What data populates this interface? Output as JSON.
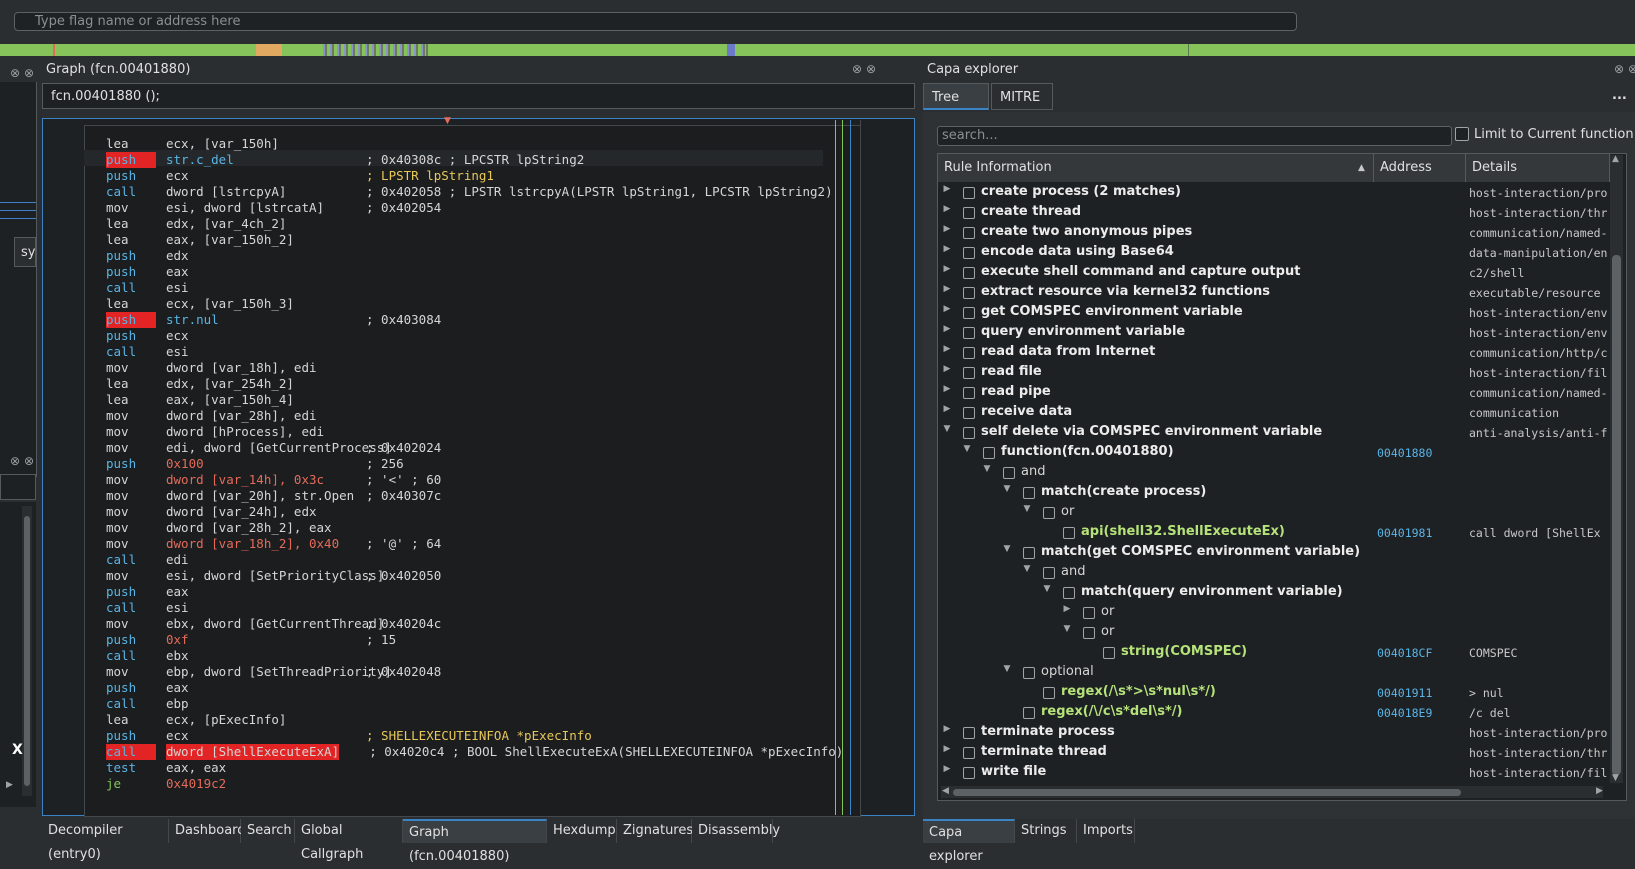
{
  "flag_search": {
    "placeholder": "Type flag name or address here"
  },
  "graph": {
    "title": "Graph (fcn.00401880)",
    "header": "fcn.00401880 ();",
    "lines": [
      {
        "mn": "lea",
        "op": "ecx, [var_150h]",
        "cm": ""
      },
      {
        "mn": "push",
        "hl": true,
        "op": "str.c_del",
        "cm": "; 0x40308c ; LPCSTR lpString2"
      },
      {
        "mn": "push",
        "op": "ecx",
        "cm": "; LPSTR lpString1"
      },
      {
        "mn": "call",
        "op": "dword [lstrcpyA]",
        "cm": "; 0x402058 ; LPSTR lstrcpyA(LPSTR lpString1, LPCSTR lpString2)"
      },
      {
        "mn": "mov",
        "op": "esi, dword [lstrcatA]",
        "cm": "; 0x402054"
      },
      {
        "mn": "lea",
        "op": "edx, [var_4ch_2]",
        "cm": ""
      },
      {
        "mn": "lea",
        "op": "eax, [var_150h_2]",
        "cm": ""
      },
      {
        "mn": "push",
        "op": "edx",
        "cm": ""
      },
      {
        "mn": "push",
        "op": "eax",
        "cm": ""
      },
      {
        "mn": "call",
        "op": "esi",
        "cm": ""
      },
      {
        "mn": "lea",
        "op": "ecx, [var_150h_3]",
        "cm": ""
      },
      {
        "mn": "push",
        "hl": true,
        "op": "str.nul",
        "cm": "; 0x403084"
      },
      {
        "mn": "push",
        "op": "ecx",
        "cm": ""
      },
      {
        "mn": "call",
        "op": "esi",
        "cm": ""
      },
      {
        "mn": "mov",
        "op": "dword [var_18h], edi",
        "cm": ""
      },
      {
        "mn": "lea",
        "op": "edx, [var_254h_2]",
        "cm": ""
      },
      {
        "mn": "lea",
        "op": "eax, [var_150h_4]",
        "cm": ""
      },
      {
        "mn": "mov",
        "op": "dword [var_28h], edi",
        "cm": ""
      },
      {
        "mn": "mov",
        "op": "dword [hProcess], edi",
        "cm": ""
      },
      {
        "mn": "mov",
        "op": "edi, dword [GetCurrentProcess]",
        "cm": "; 0x402024"
      },
      {
        "mn": "push",
        "op": "0x100",
        "cm": "; 256"
      },
      {
        "mn": "mov",
        "op": "dword [var_14h], 0x3c",
        "cm": "; '<' ; 60"
      },
      {
        "mn": "mov",
        "op": "dword [var_20h], str.Open",
        "cm": "; 0x40307c"
      },
      {
        "mn": "mov",
        "op": "dword [var_24h], edx",
        "cm": ""
      },
      {
        "mn": "mov",
        "op": "dword [var_28h_2], eax",
        "cm": ""
      },
      {
        "mn": "mov",
        "op": "dword [var_18h_2], 0x40",
        "cm": "; '@' ; 64"
      },
      {
        "mn": "call",
        "op": "edi",
        "cm": ""
      },
      {
        "mn": "mov",
        "op": "esi, dword [SetPriorityClass]",
        "cm": "; 0x402050"
      },
      {
        "mn": "push",
        "op": "eax",
        "cm": ""
      },
      {
        "mn": "call",
        "op": "esi",
        "cm": ""
      },
      {
        "mn": "mov",
        "op": "ebx, dword [GetCurrentThread]",
        "cm": "; 0x40204c"
      },
      {
        "mn": "push",
        "op": "0xf",
        "cm": "; 15"
      },
      {
        "mn": "call",
        "op": "ebx",
        "cm": ""
      },
      {
        "mn": "mov",
        "op": "ebp, dword [SetThreadPriority]",
        "cm": "; 0x402048"
      },
      {
        "mn": "push",
        "op": "eax",
        "cm": ""
      },
      {
        "mn": "call",
        "op": "ebp",
        "cm": ""
      },
      {
        "mn": "lea",
        "op": "ecx, [pExecInfo]",
        "cm": ""
      },
      {
        "mn": "push",
        "op": "ecx",
        "cm": "; SHELLEXECUTEINFOA *pExecInfo"
      },
      {
        "mn": "call",
        "hl": true,
        "op": "dword [ShellExecuteExA]",
        "cm": "; 0x4020c4 ; BOOL ShellExecuteExA(SHELLEXECUTEINFOA *pExecInfo)"
      },
      {
        "mn": "test",
        "op": "eax, eax",
        "cm": ""
      },
      {
        "mn": "je",
        "op": "0x4019c2",
        "cm": ""
      }
    ]
  },
  "left_strip": {
    "sy_label": "sy",
    "x_label": "X"
  },
  "bottom_tabs_left": [
    "Decompiler (entry0)",
    "Dashboard",
    "Search",
    "Global Callgraph",
    "Graph (fcn.00401880)",
    "Hexdump",
    "Zignatures",
    "Disassembly"
  ],
  "capa": {
    "title": "Capa explorer",
    "tabs": [
      "Tree View",
      "MITRE"
    ],
    "more": "...",
    "search_placeholder": "search...",
    "limit_label": "Limit to Current function",
    "columns": [
      "Rule Information",
      "Address",
      "Details"
    ],
    "rows": [
      {
        "level": 0,
        "arrow": "right",
        "name": "create process (2 matches)",
        "addr": "",
        "det": "host-interaction/pro"
      },
      {
        "level": 0,
        "arrow": "right",
        "name": "create thread",
        "addr": "",
        "det": "host-interaction/thr"
      },
      {
        "level": 0,
        "arrow": "right",
        "name": "create two anonymous pipes",
        "addr": "",
        "det": "communication/named-"
      },
      {
        "level": 0,
        "arrow": "right",
        "name": "encode data using Base64",
        "addr": "",
        "det": "data-manipulation/en"
      },
      {
        "level": 0,
        "arrow": "right",
        "name": "execute shell command and capture output",
        "addr": "",
        "det": "c2/shell"
      },
      {
        "level": 0,
        "arrow": "right",
        "name": "extract resource via kernel32 functions",
        "addr": "",
        "det": "executable/resource"
      },
      {
        "level": 0,
        "arrow": "right",
        "name": "get COMSPEC environment variable",
        "addr": "",
        "det": "host-interaction/env"
      },
      {
        "level": 0,
        "arrow": "right",
        "name": "query environment variable",
        "addr": "",
        "det": "host-interaction/env"
      },
      {
        "level": 0,
        "arrow": "right",
        "name": "read data from Internet",
        "addr": "",
        "det": "communication/http/c"
      },
      {
        "level": 0,
        "arrow": "right",
        "name": "read file",
        "addr": "",
        "det": "host-interaction/fil"
      },
      {
        "level": 0,
        "arrow": "right",
        "name": "read pipe",
        "addr": "",
        "det": "communication/named-"
      },
      {
        "level": 0,
        "arrow": "right",
        "name": "receive data",
        "addr": "",
        "det": "communication"
      },
      {
        "level": 0,
        "arrow": "down",
        "name": "self delete via COMSPEC environment variable",
        "addr": "",
        "det": "anti-analysis/anti-f"
      },
      {
        "level": 1,
        "arrow": "down",
        "name": "function(fcn.00401880)",
        "addr": "00401880",
        "det": "",
        "style": "bold"
      },
      {
        "level": 2,
        "arrow": "down",
        "name": "and",
        "addr": "",
        "det": "",
        "style": "plain"
      },
      {
        "level": 3,
        "arrow": "down",
        "name": "match(create process)",
        "addr": "",
        "det": "",
        "style": "bold"
      },
      {
        "level": 4,
        "arrow": "down",
        "name": "or",
        "addr": "",
        "det": "",
        "style": "plain"
      },
      {
        "level": 5,
        "arrow": "",
        "name": "api(shell32.ShellExecuteEx)",
        "addr": "00401981",
        "det": "call dword [ShellEx",
        "style": "green"
      },
      {
        "level": 3,
        "arrow": "down",
        "name": "match(get COMSPEC environment variable)",
        "addr": "",
        "det": "",
        "style": "bold"
      },
      {
        "level": 4,
        "arrow": "down",
        "name": "and",
        "addr": "",
        "det": "",
        "style": "plain"
      },
      {
        "level": 5,
        "arrow": "down",
        "name": "match(query environment variable)",
        "addr": "",
        "det": "",
        "style": "bold"
      },
      {
        "level": 6,
        "arrow": "right",
        "name": "or",
        "addr": "",
        "det": "",
        "style": "plain"
      },
      {
        "level": 6,
        "arrow": "down",
        "name": "or",
        "addr": "",
        "det": "",
        "style": "plain"
      },
      {
        "level": 7,
        "arrow": "",
        "name": "string(COMSPEC)",
        "addr": "004018CF",
        "det": "COMSPEC",
        "style": "green"
      },
      {
        "level": 3,
        "arrow": "down",
        "name": "optional",
        "addr": "",
        "det": "",
        "style": "plain"
      },
      {
        "level": 4,
        "arrow": "",
        "name": "regex(/\\s*>\\s*nul\\s*/)",
        "addr": "00401911",
        "det": " > nul",
        "style": "green"
      },
      {
        "level": 3,
        "arrow": "",
        "name": "regex(/\\/c\\s*del\\s*/)",
        "addr": "004018E9",
        "det": "/c del",
        "style": "green"
      },
      {
        "level": 0,
        "arrow": "right",
        "name": "terminate process",
        "addr": "",
        "det": "host-interaction/pro"
      },
      {
        "level": 0,
        "arrow": "right",
        "name": "terminate thread",
        "addr": "",
        "det": "host-interaction/thr"
      },
      {
        "level": 0,
        "arrow": "right",
        "name": "write file",
        "addr": "",
        "det": "host-interaction/fil"
      }
    ]
  },
  "bottom_tabs_right": [
    "Capa explorer",
    "Strings",
    "Imports"
  ],
  "colors": {
    "accent": "#3a84c6",
    "highlight": "#e22424",
    "navbar": "#86c35a",
    "match_green": "#b5e27a"
  }
}
